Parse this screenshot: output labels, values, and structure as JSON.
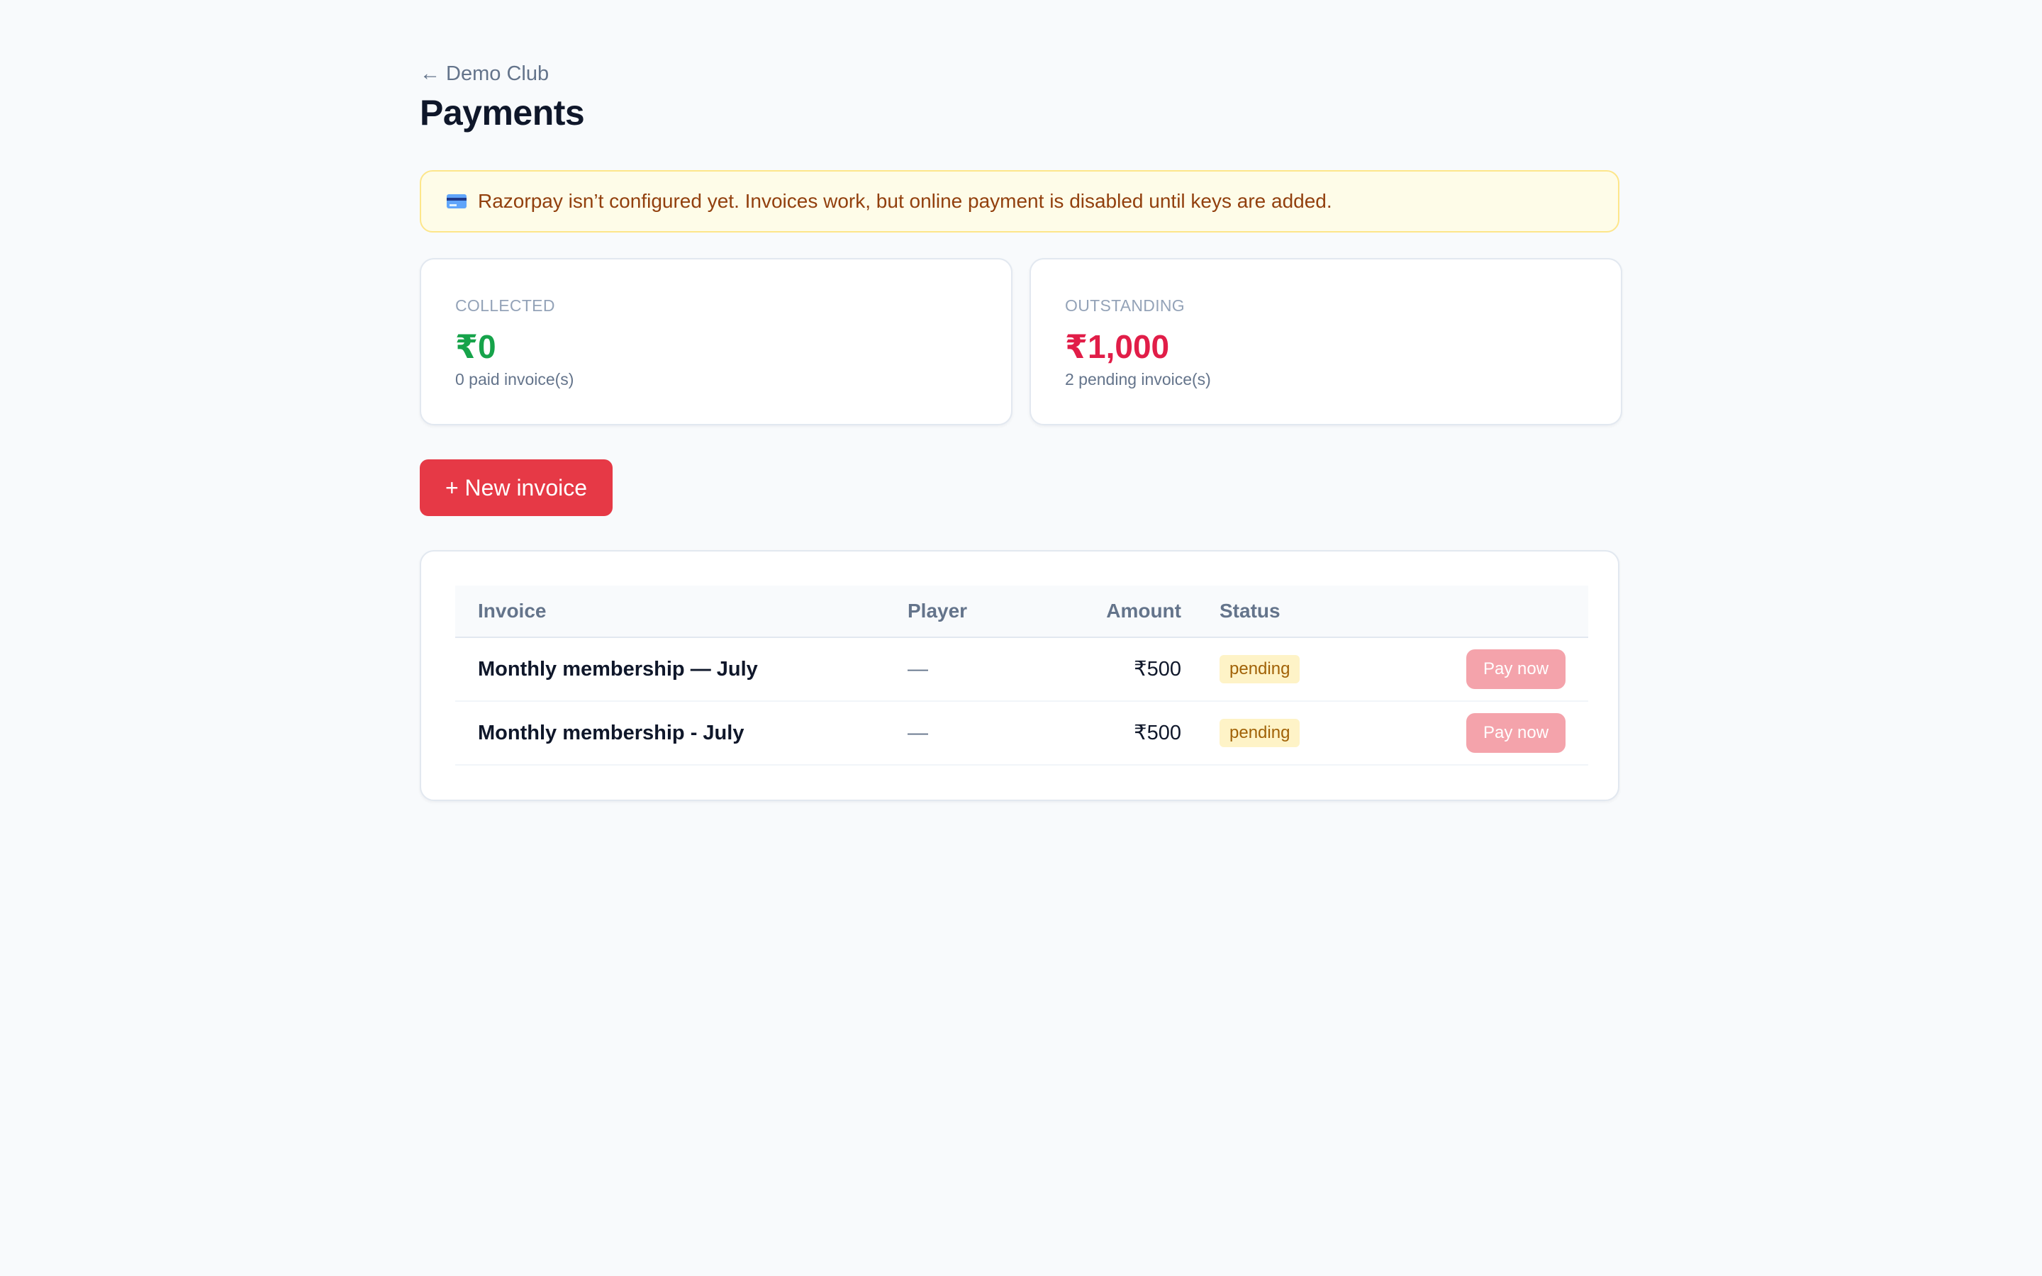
{
  "nav": {
    "back_label": "← Demo Club"
  },
  "page": {
    "title": "Payments"
  },
  "notice": {
    "icon": "credit-card-icon",
    "text": "Razorpay isn’t configured yet. Invoices work, but online payment is disabled until keys are added."
  },
  "stats": {
    "collected": {
      "label": "COLLECTED",
      "value": "₹0",
      "sub": "0 paid invoice(s)",
      "color": "#16a34a"
    },
    "outstanding": {
      "label": "OUTSTANDING",
      "value": "₹1,000",
      "sub": "2 pending invoice(s)",
      "color": "#e11d48"
    }
  },
  "actions": {
    "new_invoice_label": "+ New invoice",
    "accent": "#e63946"
  },
  "invoices": {
    "headers": {
      "invoice": "Invoice",
      "player": "Player",
      "amount": "Amount",
      "status": "Status"
    },
    "rows": [
      {
        "invoice": "Monthly membership — July",
        "player": "—",
        "amount": "₹500",
        "status": "pending",
        "action": "Pay now"
      },
      {
        "invoice": "Monthly membership - July",
        "player": "—",
        "amount": "₹500",
        "status": "pending",
        "action": "Pay now"
      }
    ]
  }
}
